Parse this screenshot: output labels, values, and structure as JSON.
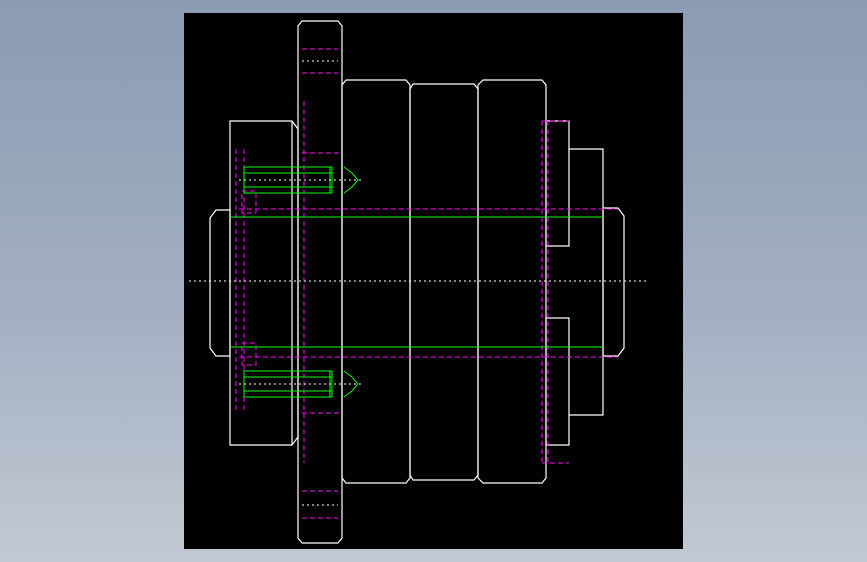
{
  "viewer": {
    "background": "#000000",
    "colors": {
      "outline": "#ffffff",
      "hidden_line": "#ff00ff",
      "bolt": "#00ff00",
      "center_line": "#ffffff"
    }
  },
  "parts": [
    "hub-left",
    "flange-disc",
    "sleeve-ring-1",
    "sleeve-ring-2",
    "sleeve-ring-3",
    "hub-right",
    "shaft-bore",
    "bolt-upper",
    "bolt-lower"
  ]
}
